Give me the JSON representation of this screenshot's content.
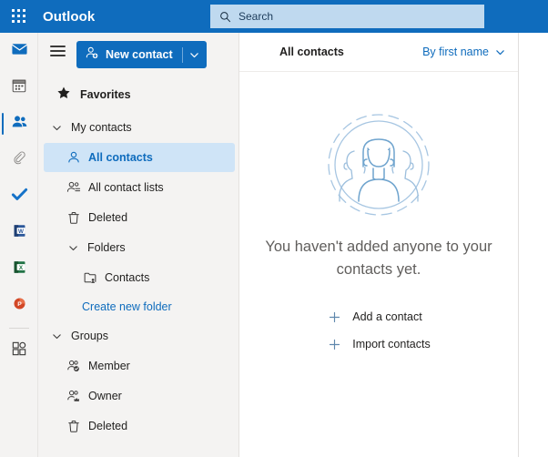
{
  "topbar": {
    "app_launcher_label": "App launcher",
    "brand": "Outlook",
    "search_placeholder": "Search",
    "search_value": ""
  },
  "app_rail": {
    "items": [
      {
        "name": "mail",
        "label": "Mail",
        "selected": false
      },
      {
        "name": "calendar",
        "label": "Calendar",
        "selected": false
      },
      {
        "name": "people",
        "label": "People",
        "selected": true
      },
      {
        "name": "files",
        "label": "Files",
        "selected": false
      },
      {
        "name": "to-do",
        "label": "To Do",
        "selected": false
      },
      {
        "name": "word",
        "label": "Word",
        "selected": false
      },
      {
        "name": "excel",
        "label": "Excel",
        "selected": false
      },
      {
        "name": "powerpoint",
        "label": "PowerPoint",
        "selected": false
      },
      {
        "name": "apps",
        "label": "Apps",
        "selected": false
      }
    ]
  },
  "sidebar": {
    "toggle_label": "Toggle navigation pane",
    "new_contact": {
      "label": "New contact",
      "caret": "∨"
    },
    "favorites": {
      "label": "Favorites"
    },
    "my_contacts": {
      "label": "My contacts",
      "items": [
        {
          "label": "All contacts",
          "icon": "person-icon",
          "selected": true
        },
        {
          "label": "All contact lists",
          "icon": "people-list-icon",
          "selected": false
        },
        {
          "label": "Deleted",
          "icon": "trash-icon",
          "selected": false
        }
      ]
    },
    "folders": {
      "label": "Folders",
      "items": [
        {
          "label": "Contacts",
          "icon": "contacts-folder-icon"
        }
      ],
      "create_link": "Create new folder"
    },
    "groups": {
      "label": "Groups",
      "items": [
        {
          "label": "Member",
          "icon": "group-member-icon"
        },
        {
          "label": "Owner",
          "icon": "group-owner-icon"
        },
        {
          "label": "Deleted",
          "icon": "trash-icon"
        }
      ]
    }
  },
  "list_pane": {
    "title": "All contacts",
    "sort_label": "By first name",
    "sort_caret": "∨",
    "empty_state": {
      "message": "You haven't added anyone to your contacts yet.",
      "actions": [
        {
          "label": "Add a contact",
          "icon": "plus-icon"
        },
        {
          "label": "Import contacts",
          "icon": "plus-icon"
        }
      ]
    }
  },
  "colors": {
    "brand_blue": "#0f6cbd",
    "search_blue": "#bfd9ef",
    "sidebar_gray": "#f4f3f2",
    "selected_blue": "#cfe4f7",
    "illustration_blue": "#8cb4d8",
    "word_blue": "#2b579a",
    "excel_green": "#217346",
    "powerpoint_orange": "#d24726"
  }
}
